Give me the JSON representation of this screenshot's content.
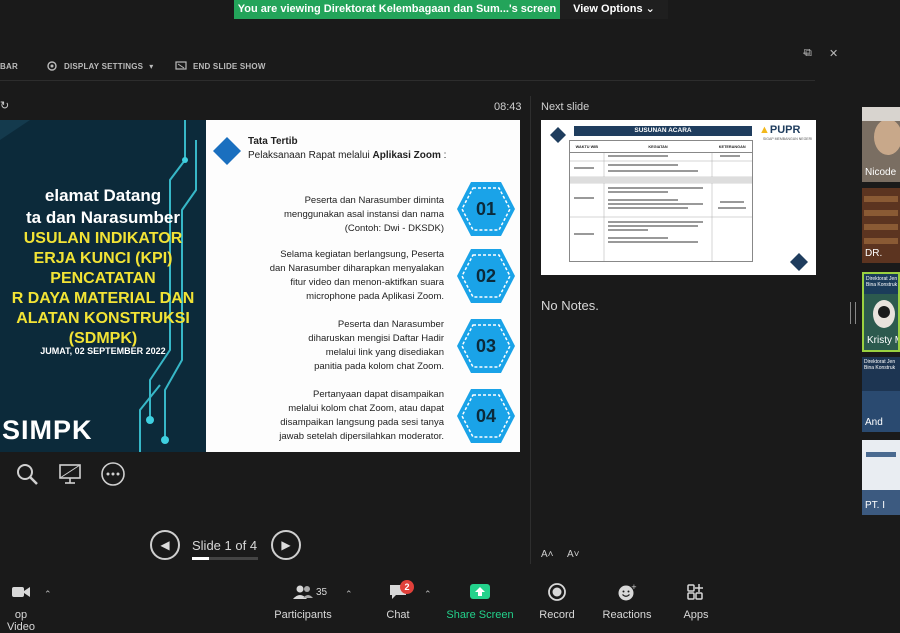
{
  "share_banner": {
    "text": "You are viewing Direktorat Kelembagaan dan Sum...'s screen",
    "options_label": "View Options"
  },
  "presenter_toolbar": {
    "bar_fragment": "BAR",
    "display_settings": "DISPLAY SETTINGS",
    "end_show": "END SLIDE SHOW"
  },
  "window_controls": [
    "–",
    "⧉",
    "✕"
  ],
  "timer": "08:43",
  "current_slide": {
    "left_panel": {
      "greeting_1": "elamat Datang",
      "greeting_2": "ta dan Narasumber",
      "topic_lines": [
        "USULAN INDIKATOR",
        "ERJA KUNCI (KPI)",
        "PENCATATAN",
        "R DAYA MATERIAL DAN",
        "ALATAN KONSTRUKSI",
        "(SDMPK)"
      ],
      "date": "JUMAT, 02 SEPTEMBER 2022",
      "logo_text": "SIMPK"
    },
    "right_panel": {
      "title": "Tata Tertib",
      "subtitle_plain": "Pelaksanaan Rapat melalui ",
      "subtitle_bold": "Aplikasi Zoom",
      "subtitle_end": " :",
      "rules": [
        {
          "number": "01",
          "lines": [
            "Peserta dan Narasumber diminta",
            "menggunakan asal instansi dan nama",
            "(Contoh: Dwi - DKSDK)"
          ]
        },
        {
          "number": "02",
          "lines": [
            "Selama kegiatan berlangsung, Peserta",
            "dan Narasumber diharapkan menyalakan",
            "fitur video dan menon-aktifkan suara",
            "microphone pada Aplikasi Zoom."
          ]
        },
        {
          "number": "03",
          "lines": [
            "Peserta dan Narasumber",
            "diharuskan mengisi Daftar Hadir",
            "melalui link yang disediakan",
            "panitia pada kolom chat Zoom."
          ]
        },
        {
          "number": "04",
          "lines": [
            "Pertanyaan dapat disampaikan",
            "melalui kolom chat Zoom, atau dapat",
            "disampaikan langsung pada sesi tanya",
            "jawab setelah dipersilahkan moderator."
          ]
        }
      ]
    }
  },
  "slide_nav": {
    "indicator": "Slide 1 of 4",
    "progress": 0.25
  },
  "next_slide": {
    "label": "Next slide",
    "title": "SUSUNAN ACARA",
    "brand": "PUPR",
    "brand_sub": "SIGAP MEMBANGUN NEGERI",
    "table_headers": [
      "WAKTU WIB",
      "KEGIATAN",
      "KETERANGAN"
    ]
  },
  "notes": "No Notes.",
  "font_controls": [
    "A˄",
    "A˅"
  ],
  "participants": [
    {
      "name": "Nicode"
    },
    {
      "name": "DR."
    },
    {
      "name": "Kristy M"
    },
    {
      "name": "And"
    },
    {
      "name": "PT. I"
    }
  ],
  "thumb_slide_text": {
    "line1": "Direktorat Jen",
    "line2": "Bina Konstruk"
  },
  "bottom_bar": {
    "video": "op Video",
    "participants": "Participants",
    "participants_count": "35",
    "chat": "Chat",
    "chat_badge": "2",
    "share": "Share Screen",
    "record": "Record",
    "reactions": "Reactions",
    "apps": "Apps"
  },
  "colors": {
    "banner": "#23a45a",
    "share": "#23d18b",
    "badge": "#e0403a",
    "slide_dark": "#0c2a3a",
    "hex_badge": "#1aa3e8"
  }
}
